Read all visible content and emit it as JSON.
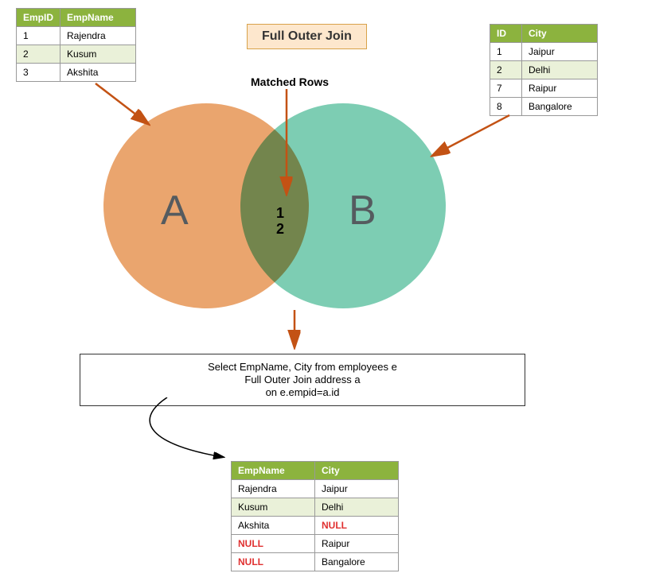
{
  "title": "Full Outer Join",
  "matched_label": "Matched Rows",
  "venn": {
    "A": "A",
    "B": "B",
    "intersect": [
      "1",
      "2"
    ]
  },
  "employees": {
    "headers": [
      "EmpID",
      "EmpName"
    ],
    "rows": [
      {
        "id": "1",
        "name": "Rajendra"
      },
      {
        "id": "2",
        "name": "Kusum"
      },
      {
        "id": "3",
        "name": "Akshita"
      }
    ]
  },
  "address": {
    "headers": [
      "ID",
      "City"
    ],
    "rows": [
      {
        "id": "1",
        "city": "Jaipur"
      },
      {
        "id": "2",
        "city": "Delhi"
      },
      {
        "id": "7",
        "city": "Raipur"
      },
      {
        "id": "8",
        "city": "Bangalore"
      }
    ]
  },
  "query": {
    "line1": "Select EmpName, City from employees e",
    "line2": "Full Outer Join address a",
    "line3": "on e.empid=a.id"
  },
  "result": {
    "headers": [
      "EmpName",
      "City"
    ],
    "rows": [
      {
        "name": "Rajendra",
        "city": "Jaipur",
        "null_name": false,
        "null_city": false
      },
      {
        "name": "Kusum",
        "city": "Delhi",
        "null_name": false,
        "null_city": false
      },
      {
        "name": "Akshita",
        "city": "NULL",
        "null_name": false,
        "null_city": true
      },
      {
        "name": "NULL",
        "city": "Raipur",
        "null_name": true,
        "null_city": false
      },
      {
        "name": "NULL",
        "city": "Bangalore",
        "null_name": true,
        "null_city": false
      }
    ]
  }
}
